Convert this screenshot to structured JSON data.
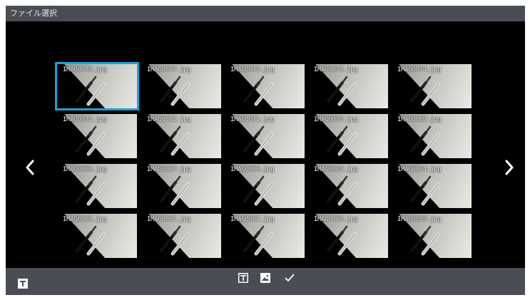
{
  "titlebar": {
    "title": "ファイル選択"
  },
  "navigation": {
    "prev_icon": "chevron-left-icon",
    "next_icon": "chevron-right-icon"
  },
  "files": [
    {
      "name": "IMAG0075.jpg",
      "selected": true
    },
    {
      "name": "IMAG0077.jpg",
      "selected": false
    },
    {
      "name": "IMAG0075.jpg",
      "selected": false
    },
    {
      "name": "IMAG0073.jpg",
      "selected": false
    },
    {
      "name": "IMAG0074.jpg",
      "selected": false
    },
    {
      "name": "IMAG0072.jpg",
      "selected": false
    },
    {
      "name": "IMAG0072.jpg",
      "selected": false
    },
    {
      "name": "IMAG0071.jpg",
      "selected": false
    },
    {
      "name": "IMAG0070.jpg",
      "selected": false
    },
    {
      "name": "IMAG0069.jpg",
      "selected": false
    },
    {
      "name": "IMAG0068.jpg",
      "selected": false
    },
    {
      "name": "IMAG0067.jpg",
      "selected": false
    },
    {
      "name": "IMAG0066.jpg",
      "selected": false
    },
    {
      "name": "IMAG0065.jpg",
      "selected": false
    },
    {
      "name": "IMAG0064.jpg",
      "selected": false
    },
    {
      "name": "IMAG0063.jpg",
      "selected": false
    },
    {
      "name": "IMAG0061.jpg",
      "selected": false
    },
    {
      "name": "IMAG0061.jpg",
      "selected": false
    },
    {
      "name": "IMAG0060.jpg",
      "selected": false
    },
    {
      "name": "IMAG0059.jpg",
      "selected": false
    }
  ],
  "bottombar": {
    "left_icon": "text-mode-icon",
    "icons": [
      "text-overlay-icon",
      "image-icon",
      "checkmark-icon"
    ]
  },
  "colors": {
    "selection": "#1ea0db",
    "bar": "#4a4d53",
    "background": "#000000"
  }
}
